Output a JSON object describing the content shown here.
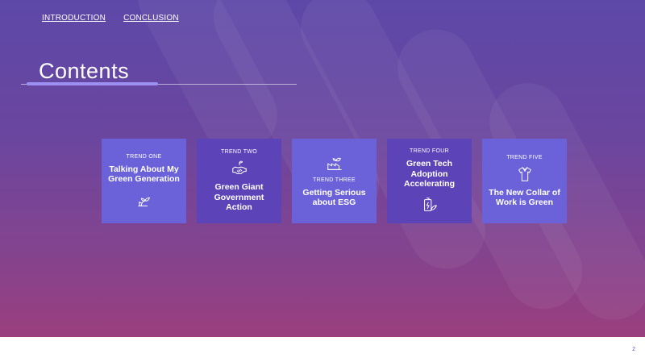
{
  "nav": {
    "introduction": "INTRODUCTION",
    "conclusion": "CONCLUSION"
  },
  "title": "Contents",
  "cards": [
    {
      "label": "TREND ONE",
      "heading": "Talking About My Green Generation",
      "icon": "plant-hand-icon"
    },
    {
      "label": "TREND TWO",
      "heading": "Green Giant Government Action",
      "icon": "handshake-icon"
    },
    {
      "label": "TREND THREE",
      "heading": "Getting Serious about ESG",
      "icon": "factory-leaf-icon"
    },
    {
      "label": "TREND FOUR",
      "heading": "Green Tech Adoption Accelerating",
      "icon": "battery-leaf-icon"
    },
    {
      "label": "TREND FIVE",
      "heading": "The New Collar of Work is Green",
      "icon": "shirt-icon"
    }
  ],
  "page_number": "2",
  "colors": {
    "card_light": "#6b62d9",
    "card_dark": "#5c44b8",
    "accent_line": "#9b8ff2",
    "page_number": "#5a4fb0"
  }
}
